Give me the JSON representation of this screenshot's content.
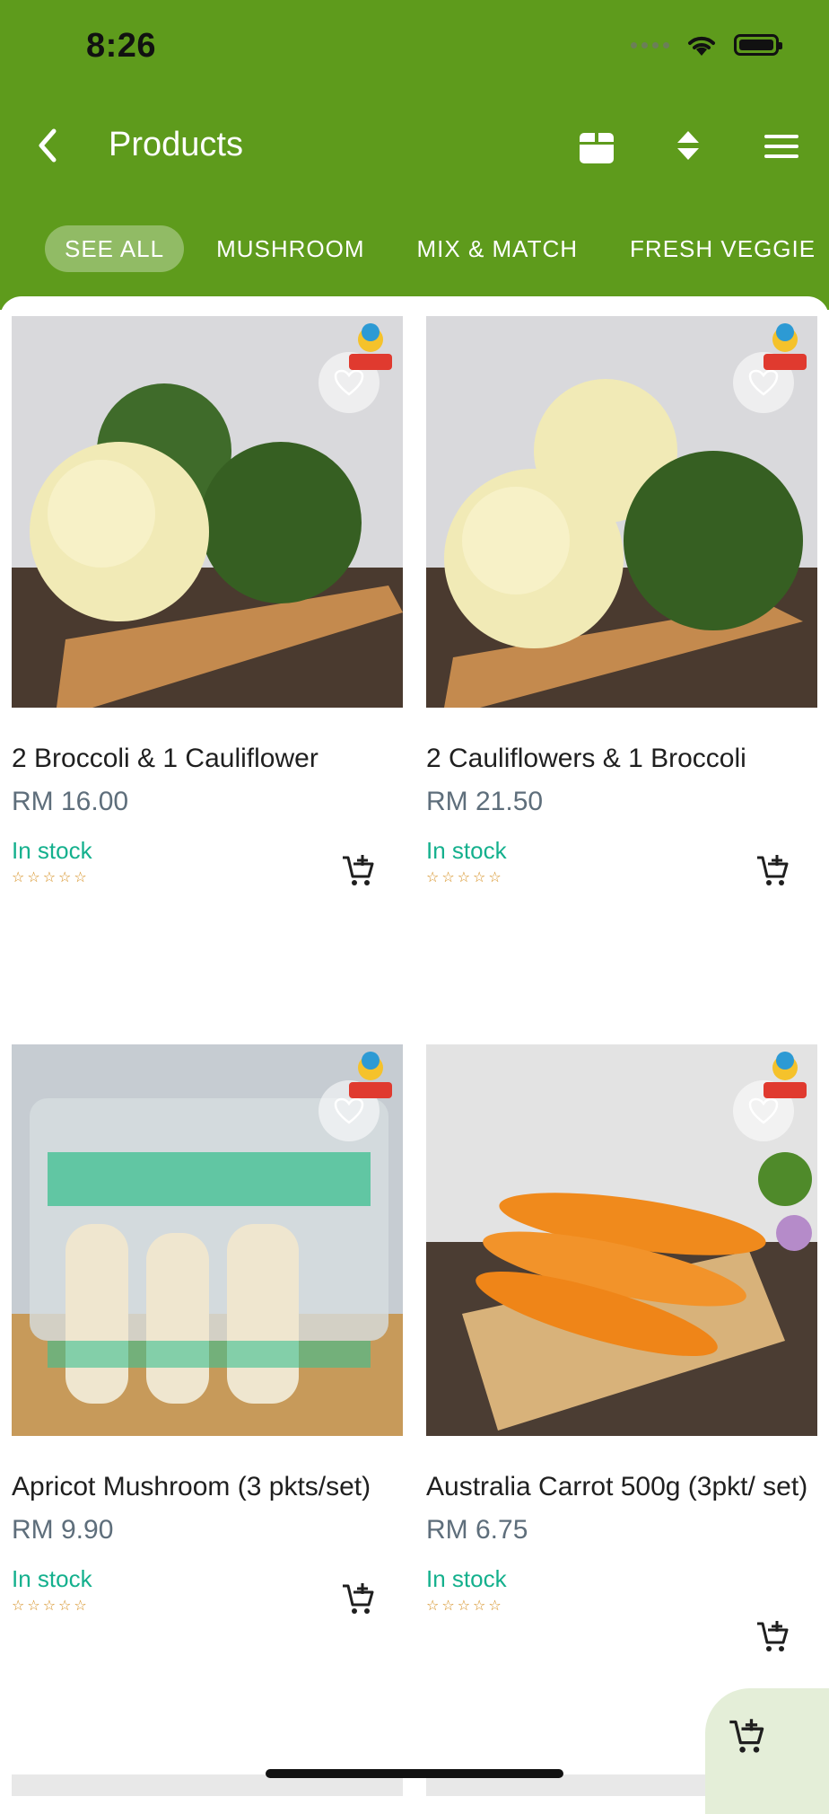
{
  "status_bar": {
    "time": "8:26"
  },
  "nav": {
    "title": "Products"
  },
  "tabs": [
    {
      "label": "SEE ALL",
      "active": true
    },
    {
      "label": "MUSHROOM",
      "active": false
    },
    {
      "label": "MIX & MATCH",
      "active": false
    },
    {
      "label": "FRESH VEGGIE",
      "active": false
    }
  ],
  "products": [
    {
      "name": "2 Broccoli & 1 Cauliflower",
      "price": "RM 16.00",
      "stock": "In stock",
      "rating_stars": 0
    },
    {
      "name": "2 Cauliflowers & 1 Broccoli",
      "price": "RM 21.50",
      "stock": "In stock",
      "rating_stars": 0
    },
    {
      "name": "Apricot Mushroom (3 pkts/set)",
      "price": "RM 9.90",
      "stock": "In stock",
      "rating_stars": 0
    },
    {
      "name": "Australia Carrot 500g (3pkt/ set)",
      "price": "RM 6.75",
      "stock": "In stock",
      "rating_stars": 0
    }
  ],
  "colors": {
    "brand_green": "#5e9b1c",
    "stock_green": "#14b08d",
    "star_orange": "#d48c1a",
    "price_gray": "#5e6e7b"
  }
}
